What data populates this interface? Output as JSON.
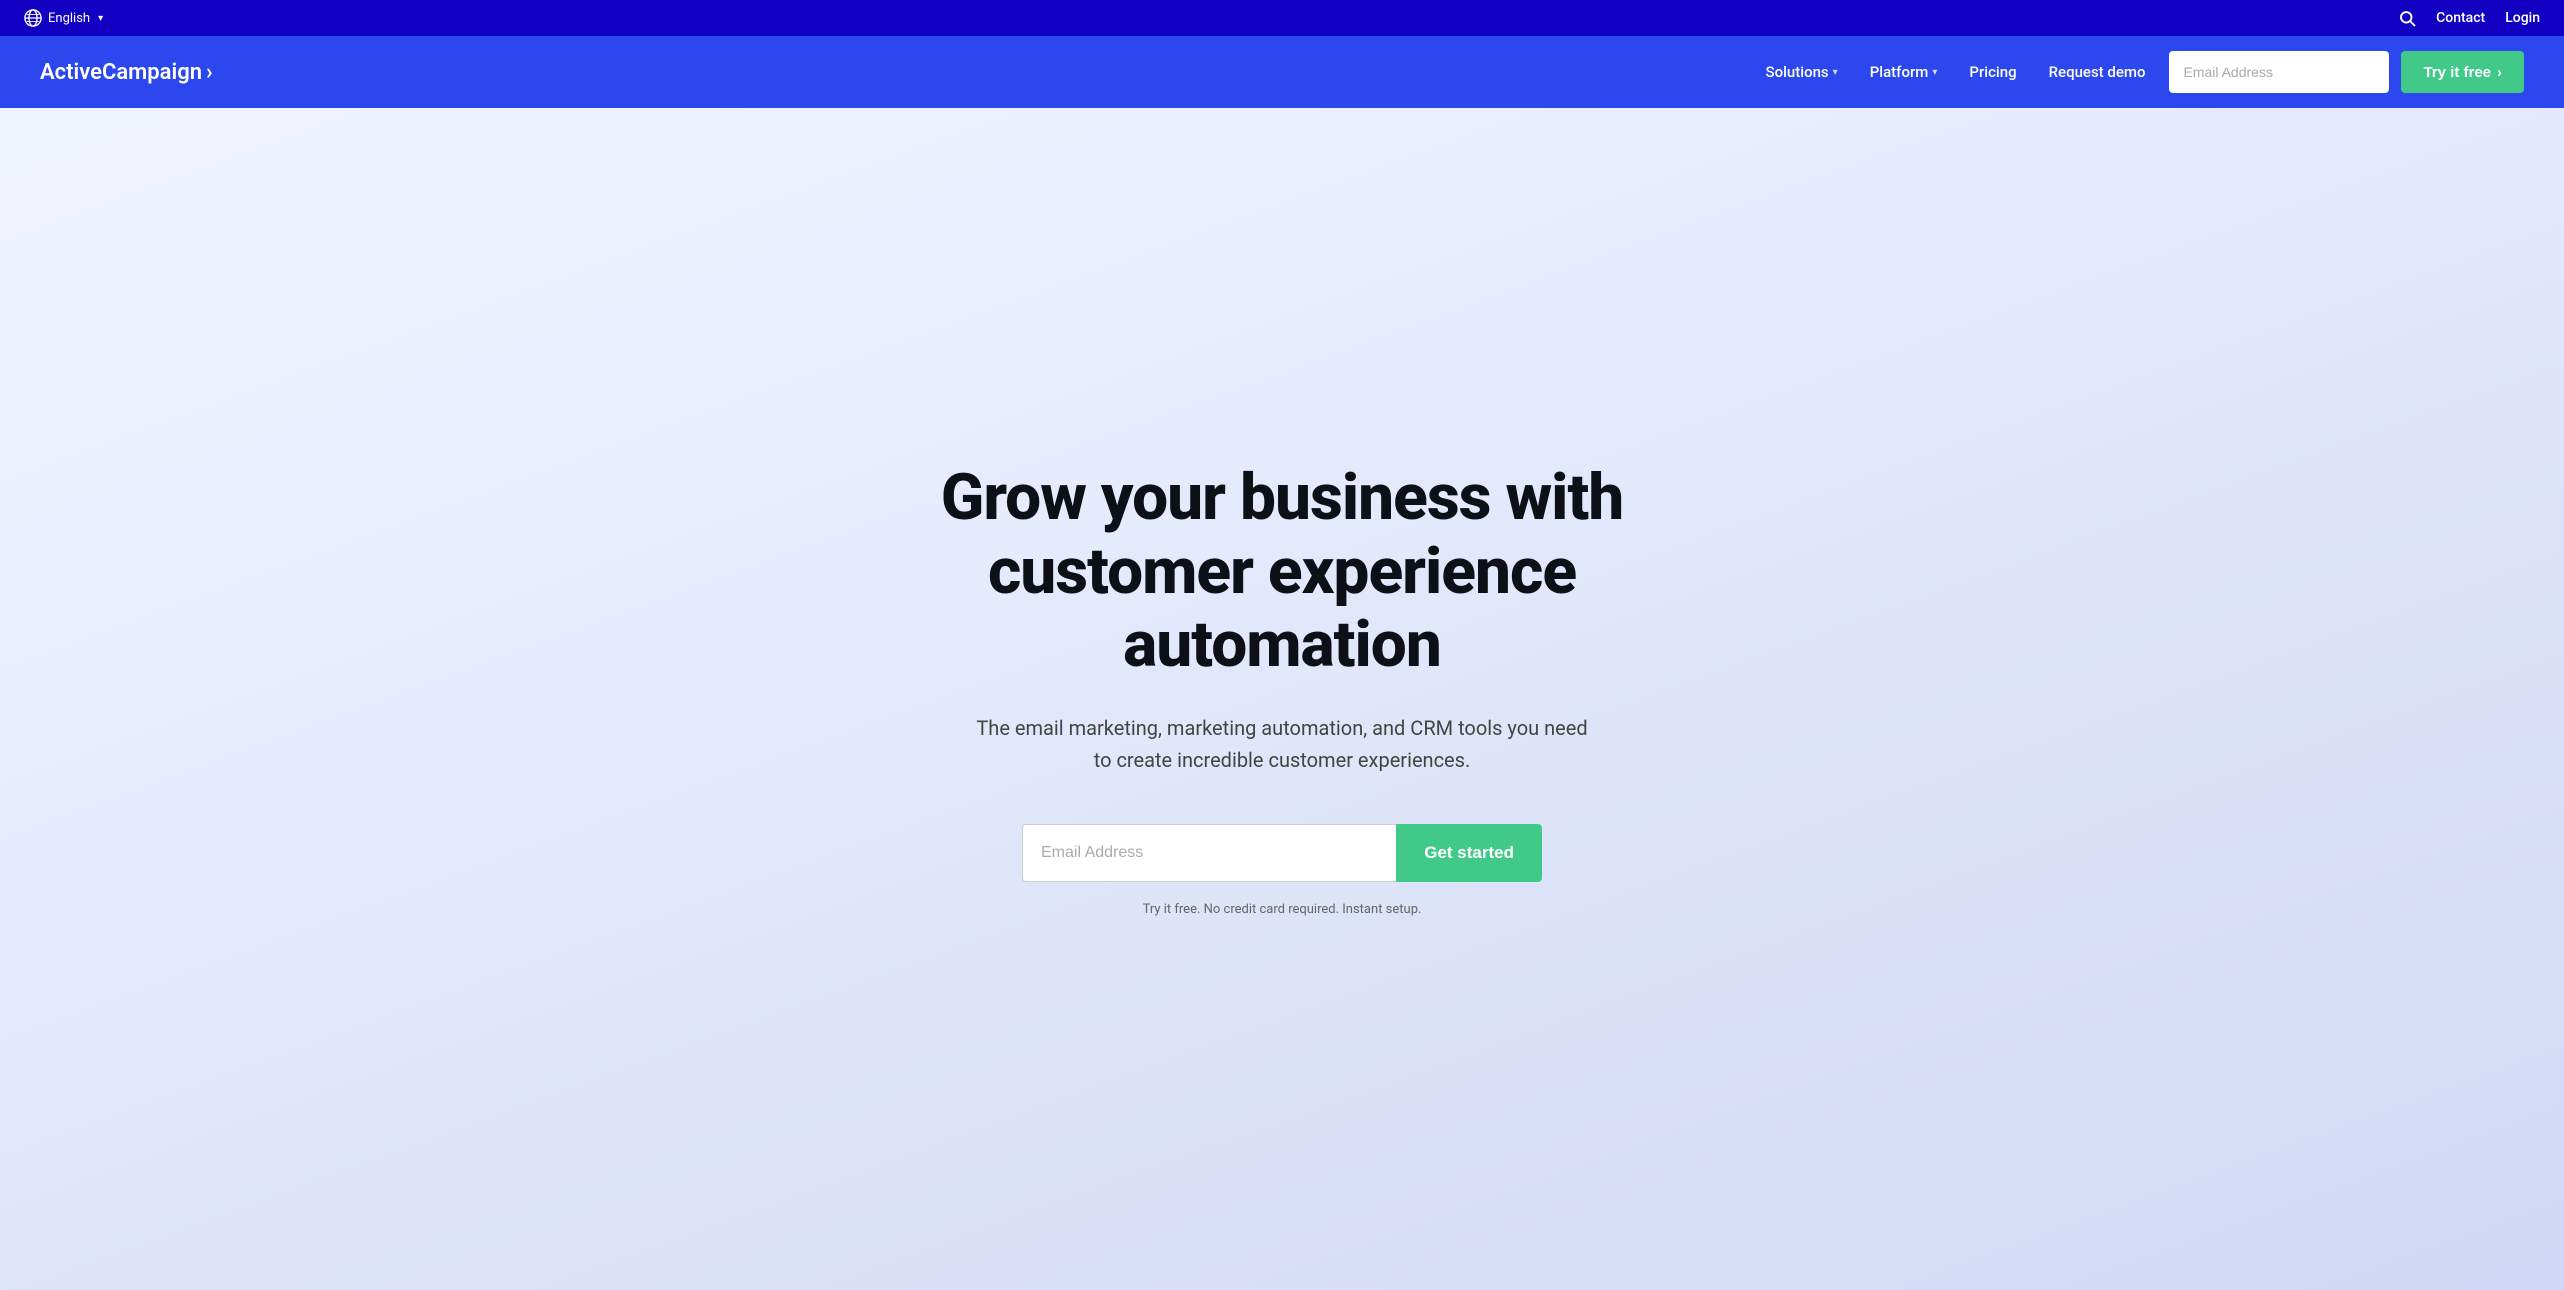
{
  "topbar": {
    "language": "English",
    "language_chevron": "▾",
    "search_label": "Search",
    "contact_label": "Contact",
    "login_label": "Login"
  },
  "nav": {
    "logo_text": "ActiveCampaign",
    "logo_arrow": "›",
    "links": [
      {
        "id": "solutions",
        "label": "Solutions",
        "has_dropdown": true
      },
      {
        "id": "platform",
        "label": "Platform",
        "has_dropdown": true
      },
      {
        "id": "pricing",
        "label": "Pricing",
        "has_dropdown": false
      },
      {
        "id": "request-demo",
        "label": "Request demo",
        "has_dropdown": false
      }
    ],
    "email_placeholder": "Email Address",
    "try_free_label": "Try it free",
    "try_free_arrow": "›"
  },
  "hero": {
    "title": "Grow your business with customer experience automation",
    "subtitle": "The email marketing, marketing automation, and CRM tools you need to create incredible customer experiences.",
    "email_placeholder": "Email Address",
    "cta_button": "Get started",
    "disclaimer": "Try it free. No credit card required. Instant setup."
  }
}
